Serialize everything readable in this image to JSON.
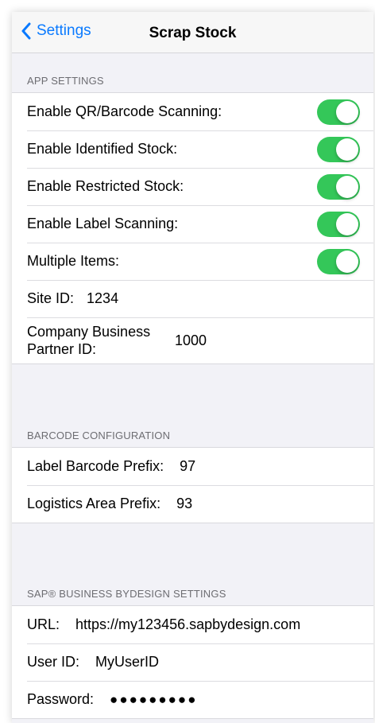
{
  "navbar": {
    "back_label": "Settings",
    "title": "Scrap Stock"
  },
  "app_settings": {
    "header": "APP SETTINGS",
    "toggles": [
      {
        "label": "Enable QR/Barcode Scanning:",
        "on": true
      },
      {
        "label": "Enable Identified Stock:",
        "on": true
      },
      {
        "label": "Enable Restricted Stock:",
        "on": true
      },
      {
        "label": "Enable Label Scanning:",
        "on": true
      },
      {
        "label": "Multiple Items:",
        "on": true
      }
    ],
    "site_id": {
      "label": "Site ID:",
      "value": "1234"
    },
    "company_bp_id": {
      "label": "Company Business Partner ID:",
      "value": "1000"
    }
  },
  "barcode_config": {
    "header": "BARCODE CONFIGURATION",
    "label_prefix": {
      "label": "Label Barcode Prefix:",
      "value": "97"
    },
    "logistics_prefix": {
      "label": "Logistics Area Prefix:",
      "value": "93"
    }
  },
  "sap_settings": {
    "header": "SAP® BUSINESS BYDESIGN SETTINGS",
    "url": {
      "label": "URL:",
      "value": "https://my123456.sapbydesign.com"
    },
    "user_id": {
      "label": "User ID:",
      "value": "MyUserID"
    },
    "password": {
      "label": "Password:",
      "value": "●●●●●●●●●"
    }
  },
  "colors": {
    "accent": "#0a7aff",
    "toggle_on": "#34c759",
    "background": "#f2f2f7"
  },
  "icons": {
    "back": "chevron-left-icon"
  }
}
